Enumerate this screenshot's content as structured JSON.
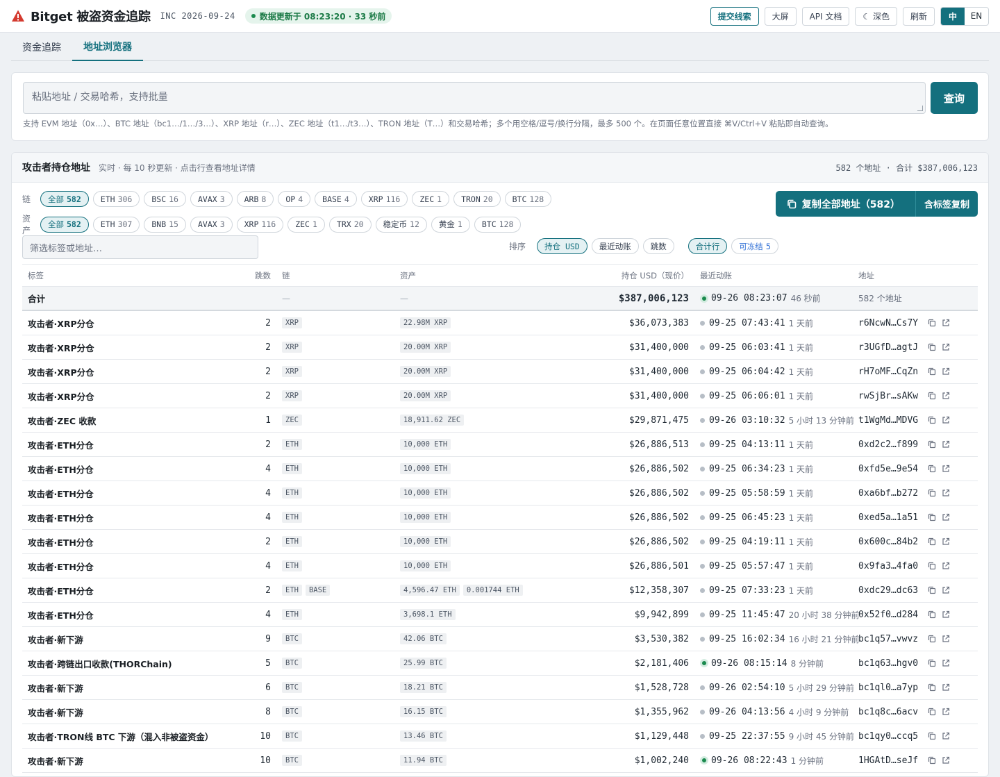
{
  "header": {
    "title": "Bitget 被盗资金追踪",
    "inc": "INC 2026-09-24",
    "update": "数据更新于 08:23:20 · 33 秒前",
    "buttons": {
      "submit_lead": "提交线索",
      "bigscreen": "大屏",
      "api_docs": "API 文档",
      "dark": "☾ 深色",
      "refresh": "刷新"
    },
    "lang": {
      "zh": "中",
      "en": "EN"
    },
    "accent": "#14707e"
  },
  "tabs": [
    "资金追踪",
    "地址浏览器"
  ],
  "search": {
    "placeholder": "粘贴地址 / 交易哈希，支持批量",
    "button": "查询",
    "hint": "支持 EVM 地址（0x…）、BTC 地址（bc1…/1…/3…）、XRP 地址（r…）、ZEC 地址（t1…/t3…）、TRON 地址（T…）和交易哈希；多个用空格/逗号/换行分隔，最多 500 个。在页面任意位置直接 ⌘V/Ctrl+V 粘贴即自动查询。"
  },
  "holdings": {
    "title": "攻击者持仓地址",
    "subtitle": "实时 · 每 10 秒更新 · 点击行查看地址详情",
    "total_summary": "582 个地址 · 合计 $387,006,123",
    "chain_label": "链",
    "asset_label": "资产",
    "chain_chips": [
      {
        "name": "全部",
        "count": "582"
      },
      {
        "name": "ETH",
        "count": "306"
      },
      {
        "name": "BSC",
        "count": "16"
      },
      {
        "name": "AVAX",
        "count": "3"
      },
      {
        "name": "ARB",
        "count": "8"
      },
      {
        "name": "OP",
        "count": "4"
      },
      {
        "name": "BASE",
        "count": "4"
      },
      {
        "name": "XRP",
        "count": "116"
      },
      {
        "name": "ZEC",
        "count": "1"
      },
      {
        "name": "TRON",
        "count": "20"
      },
      {
        "name": "BTC",
        "count": "128"
      }
    ],
    "asset_chips": [
      {
        "name": "全部",
        "count": "582"
      },
      {
        "name": "ETH",
        "count": "307"
      },
      {
        "name": "BNB",
        "count": "15"
      },
      {
        "name": "AVAX",
        "count": "3"
      },
      {
        "name": "XRP",
        "count": "116"
      },
      {
        "name": "ZEC",
        "count": "1"
      },
      {
        "name": "TRX",
        "count": "20"
      },
      {
        "name": "稳定币",
        "count": "12"
      },
      {
        "name": "黄金",
        "count": "1"
      },
      {
        "name": "BTC",
        "count": "128"
      }
    ],
    "copy_all": "复制全部地址（582）",
    "copy_with_tag": "含标签复制",
    "filter_placeholder": "筛选标签或地址…",
    "sort_label": "排序",
    "sort_options": [
      "持仓 USD",
      "最近动账",
      "跳数"
    ],
    "total_row_toggle": "合计行",
    "freezable": {
      "name": "可冻结",
      "count": "5"
    },
    "columns": [
      "标签",
      "跳数",
      "链",
      "资产",
      "持仓 USD（现价）",
      "最近动账",
      "地址"
    ],
    "total_row": {
      "label": "合计",
      "usd": "$387,006,123",
      "time": "09-26 08:23:07",
      "ago": "46 秒前",
      "addr": "582 个地址",
      "dash": "—"
    },
    "rows": [
      {
        "tag": "攻击者·XRP分仓",
        "hops": "2",
        "chains": [
          "XRP"
        ],
        "assets": [
          "22.98M XRP"
        ],
        "usd": "$36,073,383",
        "time": "09-25 07:43:41",
        "ago": "1 天前",
        "live": false,
        "addr": "r6NcwN…Cs7Y"
      },
      {
        "tag": "攻击者·XRP分仓",
        "hops": "2",
        "chains": [
          "XRP"
        ],
        "assets": [
          "20.00M XRP"
        ],
        "usd": "$31,400,000",
        "time": "09-25 06:03:41",
        "ago": "1 天前",
        "live": false,
        "addr": "r3UGfD…agtJ"
      },
      {
        "tag": "攻击者·XRP分仓",
        "hops": "2",
        "chains": [
          "XRP"
        ],
        "assets": [
          "20.00M XRP"
        ],
        "usd": "$31,400,000",
        "time": "09-25 06:04:42",
        "ago": "1 天前",
        "live": false,
        "addr": "rH7oMF…CqZn"
      },
      {
        "tag": "攻击者·XRP分仓",
        "hops": "2",
        "chains": [
          "XRP"
        ],
        "assets": [
          "20.00M XRP"
        ],
        "usd": "$31,400,000",
        "time": "09-25 06:06:01",
        "ago": "1 天前",
        "live": false,
        "addr": "rwSjBr…sAKw"
      },
      {
        "tag": "攻击者·ZEC 收款",
        "hops": "1",
        "chains": [
          "ZEC"
        ],
        "assets": [
          "18,911.62 ZEC"
        ],
        "usd": "$29,871,475",
        "time": "09-26 03:10:32",
        "ago": "5 小时 13 分钟前",
        "live": false,
        "addr": "t1WgMd…MDVG"
      },
      {
        "tag": "攻击者·ETH分仓",
        "hops": "2",
        "chains": [
          "ETH"
        ],
        "assets": [
          "10,000 ETH"
        ],
        "usd": "$26,886,513",
        "time": "09-25 04:13:11",
        "ago": "1 天前",
        "live": false,
        "addr": "0xd2c2…f899"
      },
      {
        "tag": "攻击者·ETH分仓",
        "hops": "4",
        "chains": [
          "ETH"
        ],
        "assets": [
          "10,000 ETH"
        ],
        "usd": "$26,886,502",
        "time": "09-25 06:34:23",
        "ago": "1 天前",
        "live": false,
        "addr": "0xfd5e…9e54"
      },
      {
        "tag": "攻击者·ETH分仓",
        "hops": "4",
        "chains": [
          "ETH"
        ],
        "assets": [
          "10,000 ETH"
        ],
        "usd": "$26,886,502",
        "time": "09-25 05:58:59",
        "ago": "1 天前",
        "live": false,
        "addr": "0xa6bf…b272"
      },
      {
        "tag": "攻击者·ETH分仓",
        "hops": "4",
        "chains": [
          "ETH"
        ],
        "assets": [
          "10,000 ETH"
        ],
        "usd": "$26,886,502",
        "time": "09-25 06:45:23",
        "ago": "1 天前",
        "live": false,
        "addr": "0xed5a…1a51"
      },
      {
        "tag": "攻击者·ETH分仓",
        "hops": "2",
        "chains": [
          "ETH"
        ],
        "assets": [
          "10,000 ETH"
        ],
        "usd": "$26,886,502",
        "time": "09-25 04:19:11",
        "ago": "1 天前",
        "live": false,
        "addr": "0x600c…84b2"
      },
      {
        "tag": "攻击者·ETH分仓",
        "hops": "4",
        "chains": [
          "ETH"
        ],
        "assets": [
          "10,000 ETH"
        ],
        "usd": "$26,886,501",
        "time": "09-25 05:57:47",
        "ago": "1 天前",
        "live": false,
        "addr": "0x9fa3…4fa0"
      },
      {
        "tag": "攻击者·ETH分仓",
        "hops": "2",
        "chains": [
          "ETH",
          "BASE"
        ],
        "assets": [
          "4,596.47 ETH",
          "0.001744 ETH"
        ],
        "usd": "$12,358,307",
        "time": "09-25 07:33:23",
        "ago": "1 天前",
        "live": false,
        "addr": "0xdc29…dc63"
      },
      {
        "tag": "攻击者·ETH分仓",
        "hops": "4",
        "chains": [
          "ETH"
        ],
        "assets": [
          "3,698.1 ETH"
        ],
        "usd": "$9,942,899",
        "time": "09-25 11:45:47",
        "ago": "20 小时 38 分钟前",
        "live": false,
        "addr": "0x52f0…d284"
      },
      {
        "tag": "攻击者·新下游",
        "hops": "9",
        "chains": [
          "BTC"
        ],
        "assets": [
          "42.06 BTC"
        ],
        "usd": "$3,530,382",
        "time": "09-25 16:02:34",
        "ago": "16 小时 21 分钟前",
        "live": false,
        "addr": "bc1q57…vwvz"
      },
      {
        "tag": "攻击者·跨链出口收款(THORChain)",
        "hops": "5",
        "chains": [
          "BTC"
        ],
        "assets": [
          "25.99 BTC"
        ],
        "usd": "$2,181,406",
        "time": "09-26 08:15:14",
        "ago": "8 分钟前",
        "live": true,
        "addr": "bc1q63…hgv0"
      },
      {
        "tag": "攻击者·新下游",
        "hops": "6",
        "chains": [
          "BTC"
        ],
        "assets": [
          "18.21 BTC"
        ],
        "usd": "$1,528,728",
        "time": "09-26 02:54:10",
        "ago": "5 小时 29 分钟前",
        "live": false,
        "addr": "bc1ql0…a7yp"
      },
      {
        "tag": "攻击者·新下游",
        "hops": "8",
        "chains": [
          "BTC"
        ],
        "assets": [
          "16.15 BTC"
        ],
        "usd": "$1,355,962",
        "time": "09-26 04:13:56",
        "ago": "4 小时 9 分钟前",
        "live": false,
        "addr": "bc1q8c…6acv"
      },
      {
        "tag": "攻击者·TRON线 BTC 下游（混入非被盗资金）",
        "hops": "10",
        "chains": [
          "BTC"
        ],
        "assets": [
          "13.46 BTC"
        ],
        "usd": "$1,129,448",
        "time": "09-25 22:37:55",
        "ago": "9 小时 45 分钟前",
        "live": false,
        "addr": "bc1qy0…ccq5"
      },
      {
        "tag": "攻击者·新下游",
        "hops": "10",
        "chains": [
          "BTC"
        ],
        "assets": [
          "11.94 BTC"
        ],
        "usd": "$1,002,240",
        "time": "09-26 08:22:43",
        "ago": "1 分钟前",
        "live": true,
        "addr": "1HGAtD…seJf"
      }
    ]
  }
}
